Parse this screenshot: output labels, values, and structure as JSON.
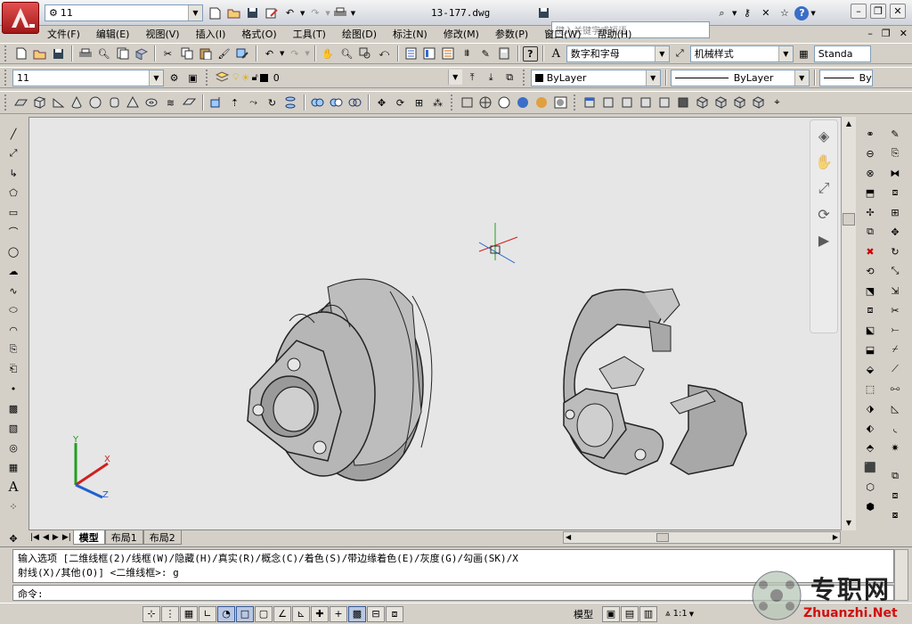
{
  "title_bar": {
    "workspace": "11",
    "filename": "13-177.dwg",
    "search_placeholder": "键入关键字或短语"
  },
  "menu_bar": {
    "items": [
      "文件(F)",
      "编辑(E)",
      "视图(V)",
      "插入(I)",
      "格式(O)",
      "工具(T)",
      "绘图(D)",
      "标注(N)",
      "修改(M)",
      "参数(P)",
      "窗口(W)",
      "帮助(H)"
    ]
  },
  "styles_toolbar": {
    "text_style": "数字和字母",
    "dim_style": "机械样式",
    "table_style": "Standa"
  },
  "layers_toolbar": {
    "workspace_combo": "11",
    "layer": "0",
    "color": "ByLayer",
    "linetype": "ByLayer",
    "lineweight": "By"
  },
  "layout_tabs": [
    "模型",
    "布局1",
    "布局2"
  ],
  "command": {
    "line1": "输入选项 [二维线框(2)/线框(W)/隐藏(H)/真实(R)/概念(C)/着色(S)/带边缘着色(E)/灰度(G)/勾画(SK)/X",
    "line2": "射线(X)/其他(O)] <二维线框>: g",
    "prompt": "命令:"
  },
  "status_bar": {
    "model_label": "模型",
    "annotation_scale": "1:1"
  },
  "watermark": {
    "cn": "专职网",
    "en": "Zhuanzhi.Net"
  },
  "colors": {
    "canvas": "#e6e6e6",
    "ucs_x": "#d02020",
    "ucs_y": "#20a020",
    "ucs_z": "#2060d0",
    "part_fill": "#a8a8a8"
  }
}
